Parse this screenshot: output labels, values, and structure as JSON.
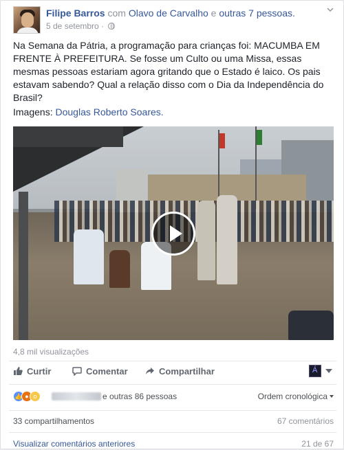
{
  "post": {
    "author": "Filipe Barros",
    "with_prefix": "com",
    "tagged_person": "Olavo de Carvalho",
    "and_word": "e",
    "others": "outras 7 pessoas.",
    "date": "5 de setembro",
    "separator": "·",
    "privacy_icon": "globe-icon",
    "text": "Na Semana da Pátria, a programação para crianças foi: MACUMBA EM FRENTE À PREFEITURA. Se fosse um Culto ou uma Missa, essas mesmas pessoas estariam agora gritando que o Estado é laico. Os pais estavam sabendo? Qual a relação disso com o Dia da Independência do Brasil?",
    "credits_label": "Imagens:",
    "credits_name": "Douglas Roberto Soares."
  },
  "video": {
    "views": "4,8 mil visualizações",
    "play_icon": "play-icon"
  },
  "actions": {
    "like": "Curtir",
    "comment": "Comentar",
    "share": "Compartilhar"
  },
  "reactions": {
    "icons": [
      "like-icon",
      "angry-icon",
      "wow-icon"
    ],
    "others_text": "e outras 86 pessoas",
    "order_label": "Ordem cronológica"
  },
  "stats": {
    "shares": "33 compartilhamentos",
    "comments": "67 comentários"
  },
  "comments_footer": {
    "view_previous": "Visualizar comentários anteriores",
    "count": "21 de 67"
  },
  "colors": {
    "link": "#365899",
    "muted": "#90949c",
    "text": "#1d2129",
    "like_blue": "#5890ff",
    "angry_orange": "#e9710f",
    "wow_yellow": "#f7c84a"
  }
}
